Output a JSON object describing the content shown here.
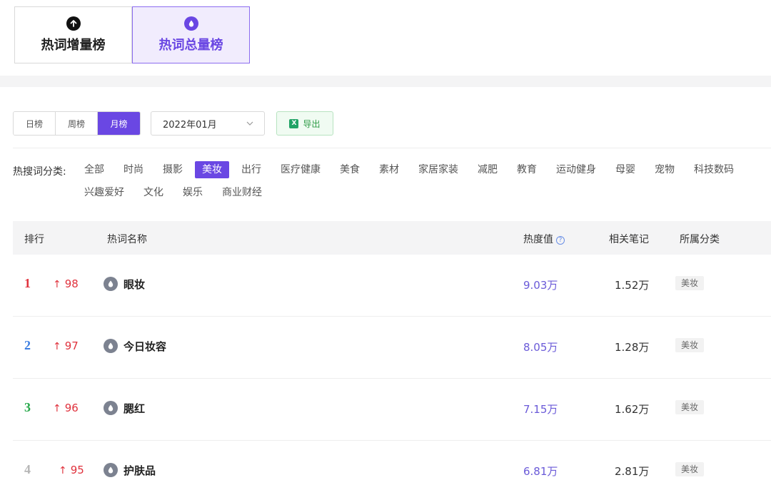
{
  "top_tabs": [
    {
      "label": "热词增量榜",
      "active": false,
      "icon": "arrow-up-circle-icon"
    },
    {
      "label": "热词总量榜",
      "active": true,
      "icon": "drop-circle-icon"
    }
  ],
  "period_tabs": [
    {
      "label": "日榜",
      "active": false
    },
    {
      "label": "周榜",
      "active": false
    },
    {
      "label": "月榜",
      "active": true
    }
  ],
  "date_select": {
    "value": "2022年01月"
  },
  "export": {
    "label": "导出",
    "icon": "excel-icon"
  },
  "category_filter": {
    "label": "热搜词分类:",
    "items": [
      "全部",
      "时尚",
      "摄影",
      "美妆",
      "出行",
      "医疗健康",
      "美食",
      "素材",
      "家居家装",
      "减肥",
      "教育",
      "运动健身",
      "母婴",
      "宠物",
      "科技数码",
      "兴趣爱好",
      "文化",
      "娱乐",
      "商业财经"
    ],
    "active": "美妆"
  },
  "table": {
    "headers": {
      "rank": "排行",
      "name": "热词名称",
      "heat": "热度值",
      "notes": "相关笔记",
      "category": "所属分类"
    },
    "rows": [
      {
        "rank": "1",
        "rank_color": "#e0323d",
        "change": "98",
        "word": "眼妆",
        "heat": "9.03万",
        "notes": "1.52万",
        "category": "美妆"
      },
      {
        "rank": "2",
        "rank_color": "#3b7de0",
        "change": "97",
        "word": "今日妆容",
        "heat": "8.05万",
        "notes": "1.28万",
        "category": "美妆"
      },
      {
        "rank": "3",
        "rank_color": "#27a84a",
        "change": "96",
        "word": "腮红",
        "heat": "7.15万",
        "notes": "1.62万",
        "category": "美妆"
      },
      {
        "rank": "4",
        "rank_color": "#b5b5b5",
        "change": "95",
        "word": "护肤品",
        "heat": "6.81万",
        "notes": "2.81万",
        "category": "美妆"
      }
    ]
  },
  "colors": {
    "accent": "#6a47e3",
    "trend_up": "#e0323d",
    "export_green": "#2d9b46"
  }
}
